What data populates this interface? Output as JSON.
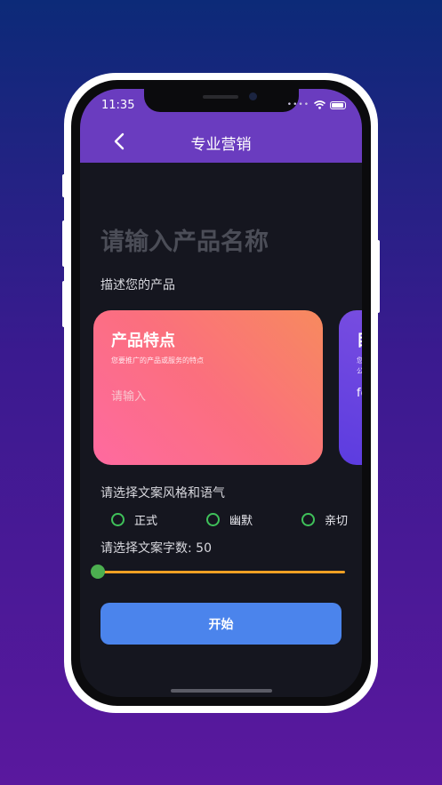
{
  "status": {
    "time": "11:35"
  },
  "header": {
    "title": "专业营销",
    "back_icon": "chevron-left-icon"
  },
  "form": {
    "product_name_placeholder": "请输入产品名称",
    "describe_label": "描述您的产品",
    "cards": [
      {
        "title": "产品特点",
        "subtitle": "您要推广的产品或服务的特点",
        "input_placeholder": "请输入"
      },
      {
        "title": "目",
        "subtitle_line1": "您",
        "subtitle_line2": "公",
        "input_placeholder": "fo"
      }
    ],
    "style_label": "请选择文案风格和语气",
    "styles": [
      "正式",
      "幽默",
      "亲切"
    ],
    "word_count_label": "请选择文案字数: 50",
    "word_count_value": 50,
    "start_button": "开始"
  },
  "colors": {
    "header": "#6a3cbf",
    "card_primary_start": "#f78a5e",
    "card_primary_end": "#fe6aa0",
    "card_secondary": "#5c3ce0",
    "radio": "#3fc15a",
    "slider_track": "#f0a024",
    "slider_thumb": "#4caf50",
    "button": "#4b84ec"
  }
}
